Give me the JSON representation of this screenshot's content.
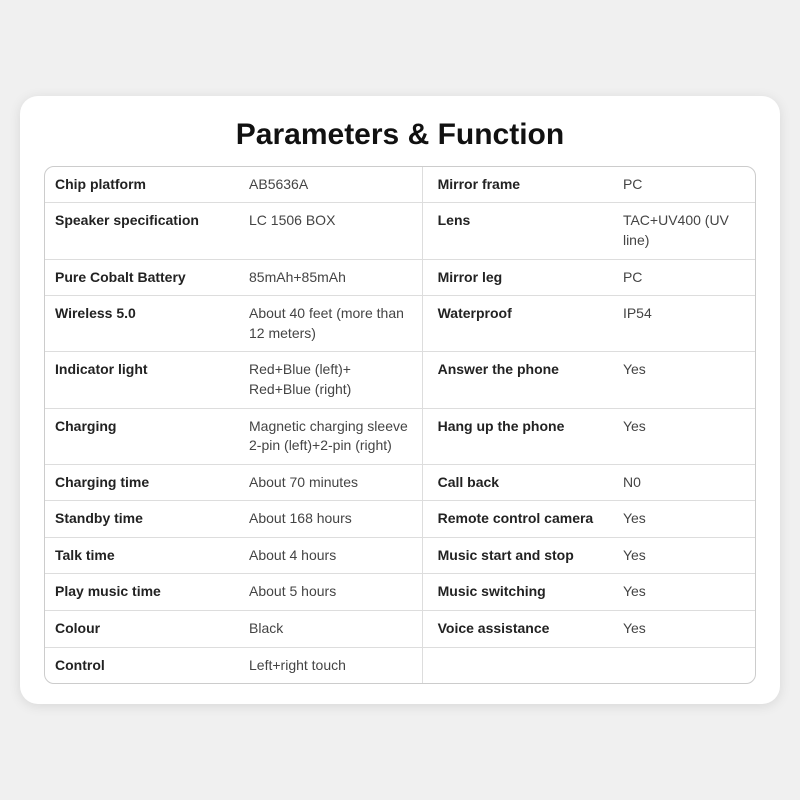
{
  "title": "Parameters & Function",
  "rows": [
    {
      "label1": "Chip platform",
      "value1": "AB5636A",
      "label2": "Mirror frame",
      "value2": "PC"
    },
    {
      "label1": "Speaker specification",
      "value1": "LC  1506 BOX",
      "label2": "Lens",
      "value2": "TAC+UV400 (UV line)"
    },
    {
      "label1": "Pure Cobalt Battery",
      "value1": "85mAh+85mAh",
      "label2": "Mirror leg",
      "value2": "PC"
    },
    {
      "label1": "Wireless 5.0",
      "value1": "About 40 feet (more than 12 meters)",
      "label2": "Waterproof",
      "value2": "IP54"
    },
    {
      "label1": "Indicator light",
      "value1": "Red+Blue (left)+ Red+Blue (right)",
      "label2": "Answer the phone",
      "value2": "Yes"
    },
    {
      "label1": "Charging",
      "value1": "Magnetic charging sleeve 2-pin (left)+2-pin (right)",
      "label2": "Hang up the phone",
      "value2": "Yes"
    },
    {
      "label1": "Charging time",
      "value1": "About 70 minutes",
      "label2": "Call back",
      "value2": "N0"
    },
    {
      "label1": "Standby time",
      "value1": "About 168 hours",
      "label2": "Remote control camera",
      "value2": "Yes"
    },
    {
      "label1": "Talk time",
      "value1": "About 4 hours",
      "label2": "Music start and stop",
      "value2": "Yes"
    },
    {
      "label1": "Play music time",
      "value1": "About 5 hours",
      "label2": "Music switching",
      "value2": "Yes"
    },
    {
      "label1": "Colour",
      "value1": "Black",
      "label2": "Voice assistance",
      "value2": "Yes"
    },
    {
      "label1": "Control",
      "value1": "Left+right touch",
      "label2": "",
      "value2": ""
    }
  ]
}
